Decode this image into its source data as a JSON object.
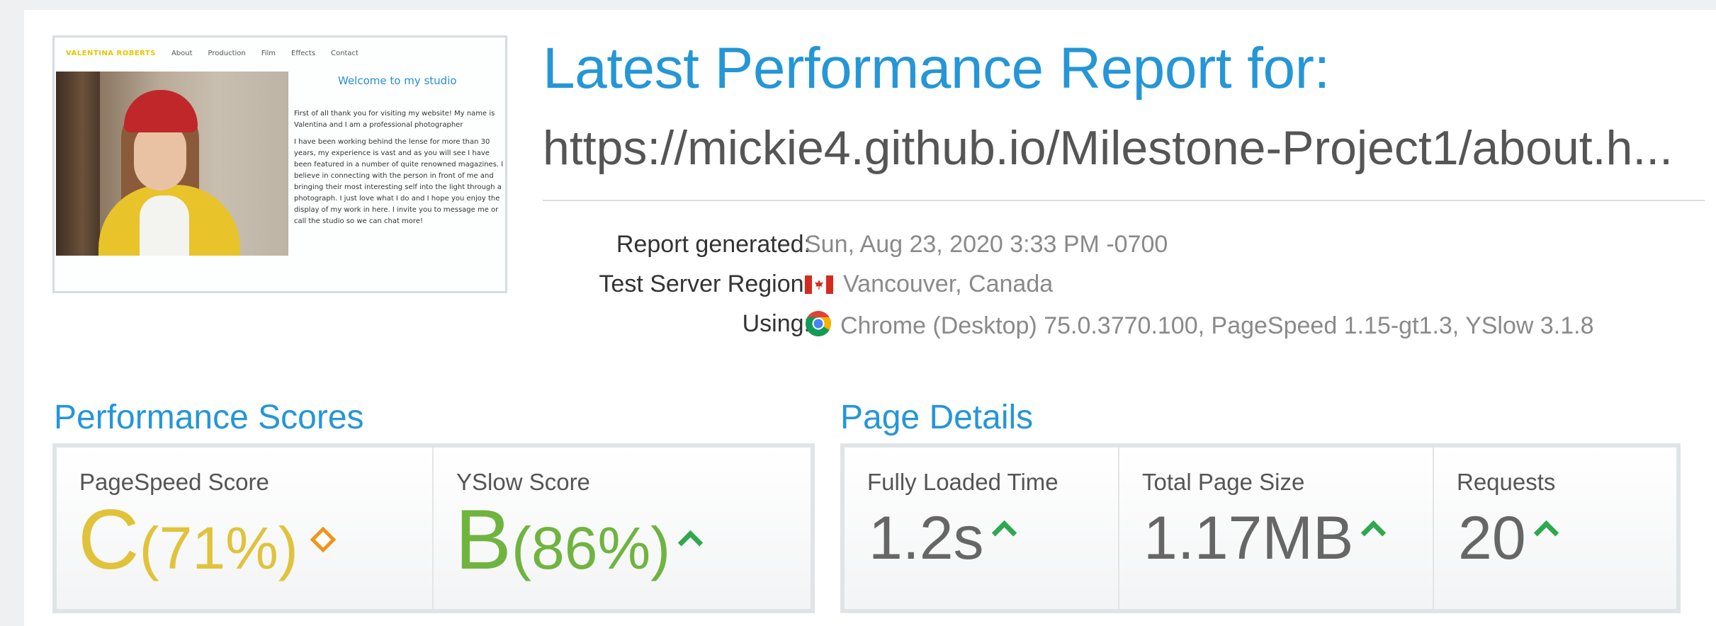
{
  "header": {
    "title": "Latest Performance Report for:",
    "url": "https://mickie4.github.io/Milestone-Project1/about.h..."
  },
  "thumbnail": {
    "brand": "VALENTINA ROBERTS",
    "nav": [
      "About",
      "Production",
      "Film",
      "Effects",
      "Contact"
    ],
    "heading": "Welcome to my studio",
    "paragraphs": [
      "First of all thank you for visiting my website! My name is Valentina and I am a professional photographer",
      "I have been working behind the lense for more than 30 years, my experience is vast and as you will see I have been featured in a number of quite renowned magazines. I believe in connecting with the person in front of me and bringing their most interesting self into the light through a photograph. I just love what I do and I hope you enjoy the display of my work in here. I invite you to message me or call the studio so we can chat more!"
    ]
  },
  "meta": {
    "report_generated_label": "Report generated:",
    "report_generated_value": "Sun, Aug 23, 2020 3:33 PM -0700",
    "region_label": "Test Server Region:",
    "region_value": "Vancouver, Canada",
    "using_label": "Using:",
    "using_value": "Chrome (Desktop) 75.0.3770.100, PageSpeed 1.15-gt1.3, YSlow 3.1.8",
    "region_icon": "canada-flag-icon",
    "browser_icon": "chrome-icon"
  },
  "performance": {
    "title": "Performance Scores",
    "pagespeed_label": "PageSpeed Score",
    "pagespeed_grade": "C",
    "pagespeed_pct": "(71%)",
    "yslow_label": "YSlow Score",
    "yslow_grade": "B",
    "yslow_pct": "(86%)"
  },
  "details": {
    "title": "Page Details",
    "load_label": "Fully Loaded Time",
    "load_value": "1.2s",
    "size_label": "Total Page Size",
    "size_value": "1.17MB",
    "requests_label": "Requests",
    "requests_value": "20"
  },
  "colors": {
    "accent": "#2596d6",
    "grade_c": "#e0c33a",
    "grade_b": "#6fb43f",
    "trend_up": "#2fa84f",
    "trend_neutral": "#f0941c"
  }
}
